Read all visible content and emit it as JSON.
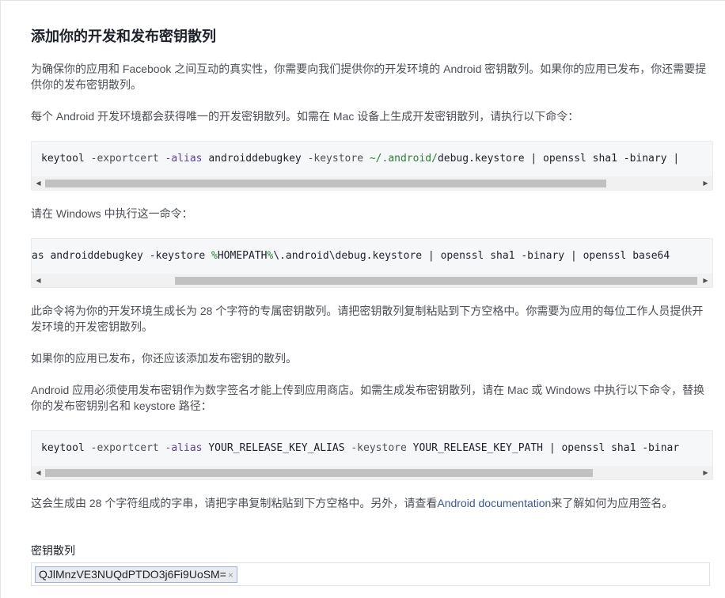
{
  "heading": "添加你的开发和发布密钥散列",
  "intro": "为确保你的应用和 Facebook 之间互动的真实性，你需要向我们提供你的开发环境的 Android 密钥散列。如果你的应用已发布，你还需要提供你的发布密钥散列。",
  "mac_instruction": "每个 Android 开发环境都会获得唯一的开发密钥散列。如需在 Mac 设备上生成开发密钥散列，请执行以下命令：",
  "mac_command": {
    "p1": "keytool ",
    "p2": "-exportcert ",
    "p3": "-alias ",
    "p4": "androiddebugkey ",
    "p5": "-keystore ",
    "p6": "~/.android/",
    "p7": "debug.keystore | openssl sha1 -binary |"
  },
  "windows_instruction": "请在 Windows 中执行这一命令：",
  "windows_command": {
    "p1": "as androiddebugkey -keystore ",
    "p2": "%",
    "p3": "HOMEPATH",
    "p4": "%",
    "p5": "\\.android\\debug.keystore | openssl sha1 -binary | openssl base64"
  },
  "hash_note": "此命令将为你的开发环境生成长为 28 个字符的专属密钥散列。请把密钥散列复制粘贴到下方空格中。你需要为应用的每位工作人员提供开发环境的开发密钥散列。",
  "release_note": "如果你的应用已发布，你还应该添加发布密钥的散列。",
  "release_instruction": "Android 应用必须使用发布密钥作为数字签名才能上传到应用商店。如需生成发布密钥散列，请在 Mac 或 Windows 中执行以下命令，替换你的发布密钥别名和 keystore 路径：",
  "release_command": {
    "p1": "keytool ",
    "p2": "-exportcert ",
    "p3": "-alias ",
    "p4": "YOUR_RELEASE_KEY_ALIAS ",
    "p5": "-keystore ",
    "p6": "YOUR_RELEASE_KEY_PATH | openssl sha1 -binar"
  },
  "outro": {
    "before_link": "这会生成由 28 个字符组成的字串，请把字串复制粘贴到下方空格中。另外，请查看",
    "link": "Android documentation",
    "after_link": "来了解如何为应用签名。"
  },
  "key_hashes": {
    "label": "密钥散列",
    "tokens": [
      "QJlMnzVE3NUQdPTDO3j6Fi9UoSM="
    ],
    "remove_glyph": "×"
  },
  "scroll": {
    "left_arrow": "◀",
    "right_arrow": "▶"
  }
}
